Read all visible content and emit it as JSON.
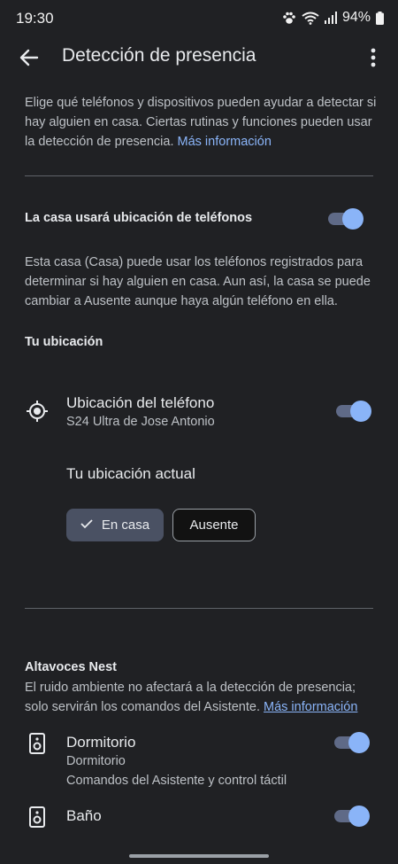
{
  "status_bar": {
    "time": "19:30",
    "battery": "94%"
  },
  "header": {
    "title": "Detección de presencia"
  },
  "intro": {
    "text": "Elige qué teléfonos y dispositivos pueden ayudar a detectar si hay alguien en casa. Ciertas rutinas y funciones pueden usar la detección de presencia.",
    "link": "Más información"
  },
  "phones_setting": {
    "title": "La casa usará ubicación de teléfonos",
    "enabled": true,
    "description": "Esta casa (Casa) puede usar los teléfonos registrados para determinar si hay alguien en casa. Aun así, la casa se puede cambiar a Ausente aunque haya algún teléfono en ella."
  },
  "your_location": {
    "title": "Tu ubicación",
    "phone_item": {
      "title": "Ubicación del teléfono",
      "subtitle": "S24 Ultra de Jose Antonio",
      "enabled": true
    },
    "current_label": "Tu ubicación actual",
    "home_button": "En casa",
    "away_button": "Ausente",
    "selected": "En casa"
  },
  "nest_speakers": {
    "title": "Altavoces Nest",
    "description": "El ruido ambiente no afectará a la detección de presencia; solo servirán los comandos del Asistente.",
    "link": "Más información",
    "items": [
      {
        "title": "Dormitorio",
        "room": "Dormitorio",
        "detail": "Comandos del Asistente y control táctil",
        "enabled": true
      },
      {
        "title": "Baño",
        "enabled": true
      }
    ]
  },
  "colors": {
    "background": "#202124",
    "accent": "#8ab4f8",
    "toggle_track": "#5f6a87"
  },
  "icons": [
    "back-arrow-icon",
    "more-vert-icon",
    "location-target-icon",
    "speaker-icon",
    "check-icon",
    "wifi-icon",
    "signal-icon",
    "battery-icon",
    "paw-icon"
  ]
}
